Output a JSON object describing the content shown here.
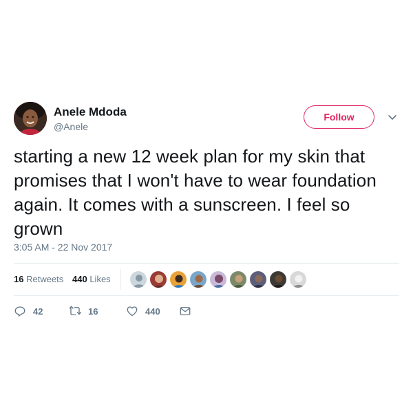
{
  "author": {
    "name": "Anele Mdoda",
    "handle": "@Anele"
  },
  "follow": {
    "label": "Follow"
  },
  "tweet": {
    "text": "starting a new 12 week plan for my skin that promises that I won't have to wear foundation again. It comes with a sunscreen. I feel so grown",
    "timestamp": "3:05 AM - 22 Nov 2017"
  },
  "stats": {
    "retweets_count": "16",
    "retweets_label": "Retweets",
    "likes_count": "440",
    "likes_label": "Likes"
  },
  "actions": {
    "replies": "42",
    "retweets": "16",
    "likes": "440"
  },
  "colors": {
    "follow_accent": "#e0245e",
    "secondary_text": "#657786",
    "divider": "#e6ecf0"
  },
  "icons": {
    "reply": "reply-icon",
    "retweet": "retweet-icon",
    "like": "heart-icon",
    "message": "envelope-icon",
    "more": "chevron-down-icon"
  }
}
